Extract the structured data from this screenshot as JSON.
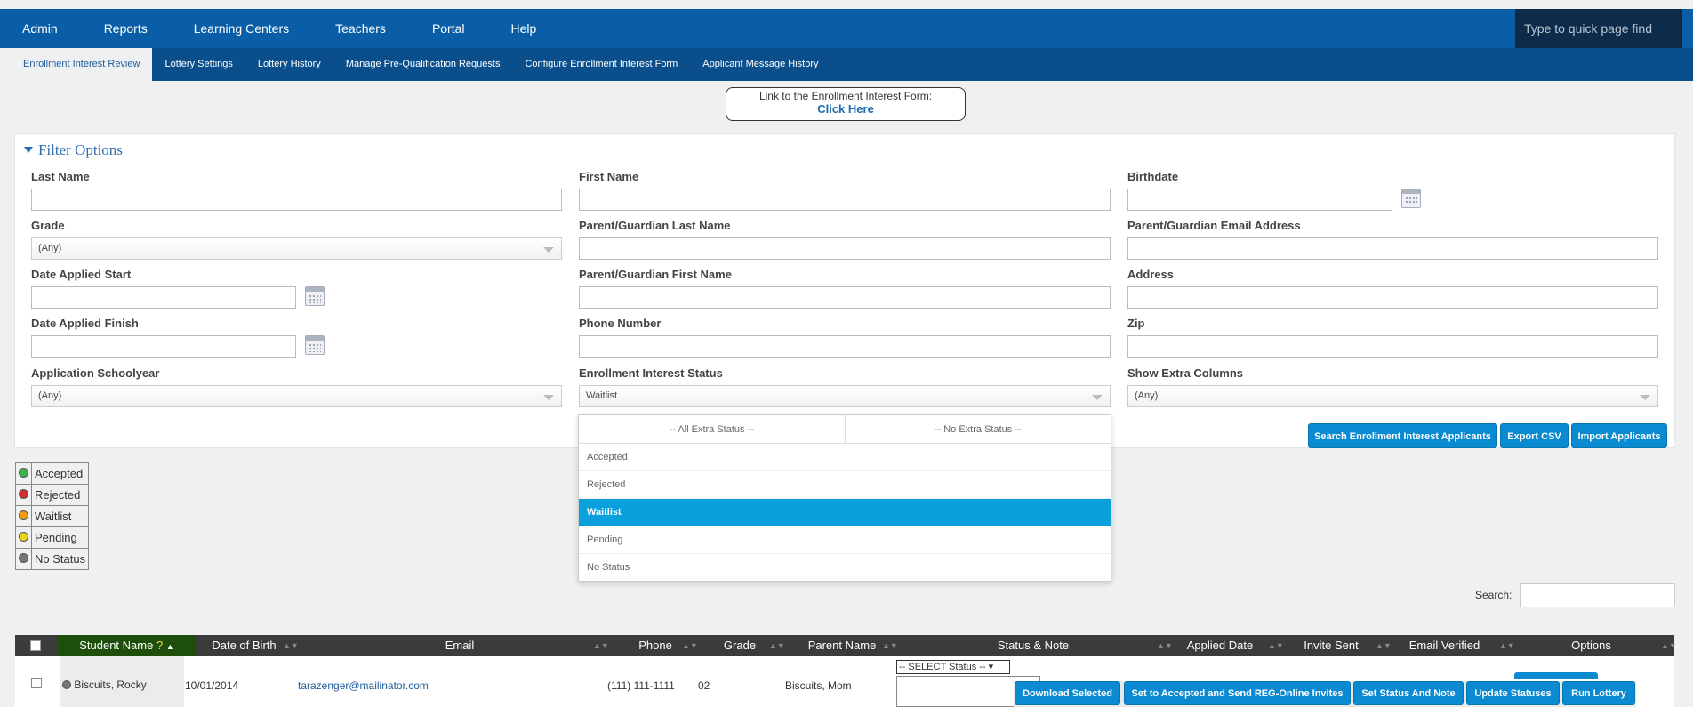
{
  "top_nav": [
    "Admin",
    "Reports",
    "Learning Centers",
    "Teachers",
    "Portal",
    "Help"
  ],
  "quick_find_placeholder": "Type to quick page find",
  "sub_nav": [
    "Enrollment Interest Review",
    "Lottery Settings",
    "Lottery History",
    "Manage Pre-Qualification Requests",
    "Configure Enrollment Interest Form",
    "Applicant Message History"
  ],
  "link_box": {
    "line1": "Link to the Enrollment Interest Form:",
    "line2": "Click Here"
  },
  "filter": {
    "title": "Filter Options",
    "labels": {
      "last_name": "Last Name",
      "first_name": "First Name",
      "birthdate": "Birthdate",
      "grade": "Grade",
      "pg_last": "Parent/Guardian Last Name",
      "pg_email": "Parent/Guardian Email Address",
      "date_start": "Date Applied Start",
      "pg_first": "Parent/Guardian First Name",
      "address": "Address",
      "date_finish": "Date Applied Finish",
      "phone": "Phone Number",
      "zip": "Zip",
      "schoolyear": "Application Schoolyear",
      "status": "Enrollment Interest Status",
      "extra_cols": "Show Extra Columns"
    },
    "values": {
      "grade": "(Any)",
      "schoolyear": "(Any)",
      "status": "Waitlist",
      "extra_cols": "(Any)"
    },
    "buttons": {
      "search": "Search Enrollment Interest Applicants",
      "export": "Export CSV",
      "import": "Import Applicants"
    }
  },
  "status_dropdown": {
    "header_left": "-- All Extra Status --",
    "header_right": "-- No Extra Status --",
    "options": [
      "Accepted",
      "Rejected",
      "Waitlist",
      "Pending",
      "No Status"
    ],
    "selected": "Waitlist"
  },
  "legend": [
    {
      "label": "Accepted",
      "color": "#3cb44b"
    },
    {
      "label": "Rejected",
      "color": "#d32f2f"
    },
    {
      "label": "Waitlist",
      "color": "#f39c12"
    },
    {
      "label": "Pending",
      "color": "#e9d21a"
    },
    {
      "label": "No Status",
      "color": "#777777"
    }
  ],
  "search_label": "Search:",
  "table": {
    "headers": [
      "Student Name",
      "?",
      "Date of Birth",
      "Email",
      "Phone",
      "Grade",
      "Parent Name",
      "Status & Note",
      "Applied Date",
      "Invite Sent",
      "Email Verified",
      "Options"
    ],
    "row": {
      "student": "Biscuits, Rocky",
      "dob": "10/01/2014",
      "email": "tarazenger@mailinator.com",
      "phone": "(111) 111-1111",
      "grade": "02",
      "parent": "Biscuits, Mom",
      "status_select": "-- SELECT Status --"
    }
  },
  "bottom_actions": [
    "Download Selected",
    "Set to Accepted and Send REG-Online Invites",
    "Set Status And Note",
    "Update Statuses",
    "Run Lottery"
  ]
}
